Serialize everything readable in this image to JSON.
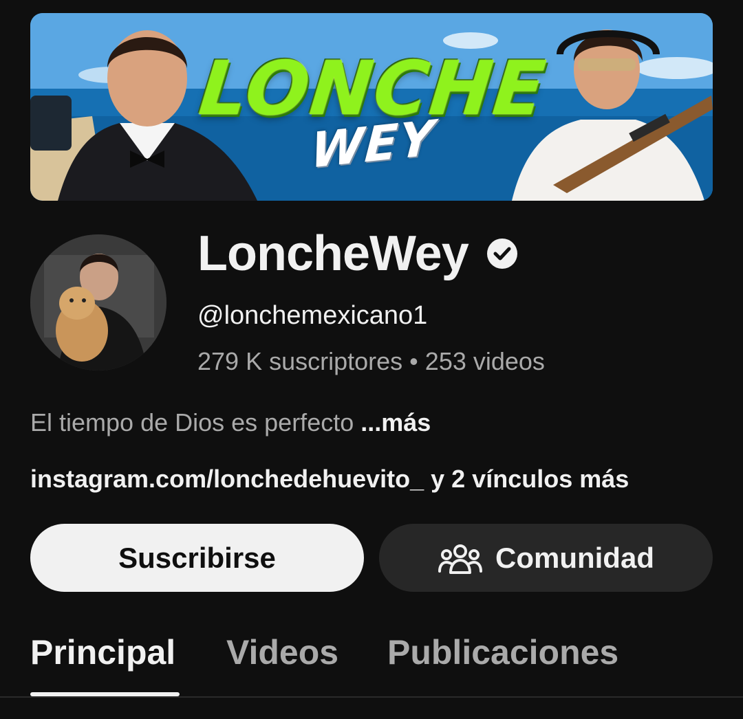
{
  "banner": {
    "title": "LONCHE",
    "subtitle": "WEY"
  },
  "channel": {
    "name": "LoncheWey",
    "handle": "@lonchemexicano1",
    "subscribers": "279 K suscriptores",
    "separator": "•",
    "videos": "253 videos",
    "description": "El tiempo de Dios es perfecto",
    "more_label": "...más",
    "links": "instagram.com/lonchedehuevito_ y 2 vínculos más"
  },
  "buttons": {
    "subscribe": "Suscribirse",
    "community": "Comunidad"
  },
  "tabs": [
    {
      "label": "Principal",
      "active": true
    },
    {
      "label": "Videos",
      "active": false
    },
    {
      "label": "Publicaciones",
      "active": false
    }
  ],
  "icons": {
    "verified": "verified-check-icon",
    "community": "people-group-icon"
  },
  "colors": {
    "background": "#0f0f0f",
    "text_primary": "#f1f1f1",
    "text_secondary": "#aaaaaa",
    "subscribe_bg": "#f1f1f1",
    "community_bg": "#272727",
    "banner_green": "#8ff21d"
  }
}
